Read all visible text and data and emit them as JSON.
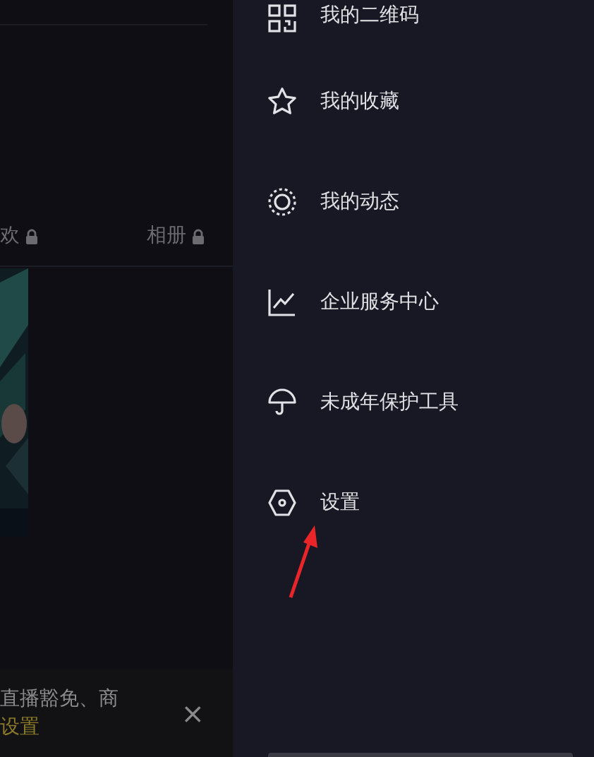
{
  "profile_tabs": [
    {
      "label": "欢",
      "locked": true
    },
    {
      "label": "相册",
      "locked": true
    }
  ],
  "banner": {
    "text": "直播豁免、商",
    "link": "设置",
    "close": "×"
  },
  "drawer": {
    "items": [
      {
        "label": "我的二维码",
        "kind": "qr"
      },
      {
        "label": "我的收藏",
        "kind": "star"
      },
      {
        "label": "我的动态",
        "kind": "ring"
      },
      {
        "label": "企业服务中心",
        "kind": "chart"
      },
      {
        "label": "未成年保护工具",
        "kind": "umbrella"
      },
      {
        "label": "设置",
        "kind": "hex"
      }
    ]
  }
}
